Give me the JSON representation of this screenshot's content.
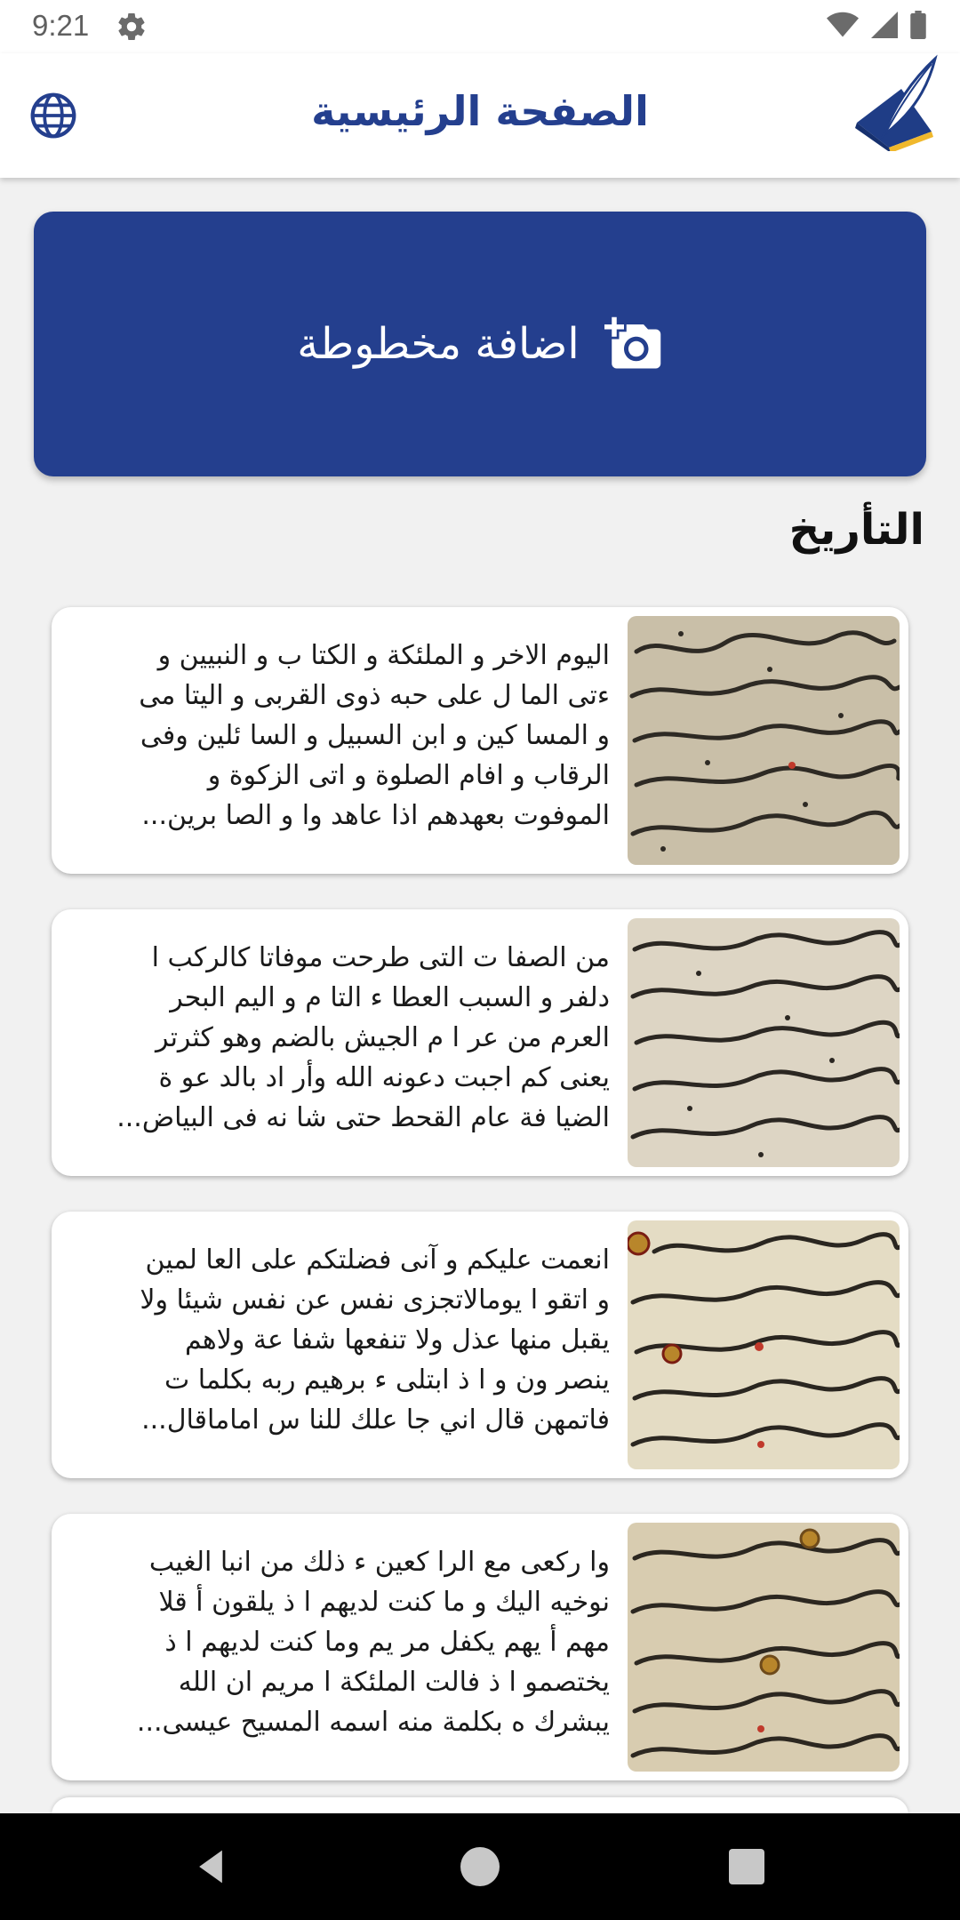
{
  "status_bar": {
    "time": "9:21"
  },
  "app_bar": {
    "title": "الصفحة الرئيسية"
  },
  "add_button": {
    "label": "اضافة مخطوطة"
  },
  "history": {
    "heading": "التأريخ",
    "items": [
      {
        "text": "اليوم الاخر و الملئكة و الكتا ب و النبيين و\nءتى الما ل على حبه ذوى القربى و اليتا مى\nو المسا كين و ابن السبيل و السا ئلين وفى\nالرقاب و افام الصلوة و اتى الزكوة و\nالموفوت بعهدهم اذا عاهد وا و الصا برين..."
      },
      {
        "text": "من الصفا ت التى طرحت موفاتا كالركب ا\nدلفر و السبب العطا ء التا م و اليم البحر\nالعرم من عر ا م الجيش  بالضم وهو كثرتر\nيعنى كم  اجبت دعونه الله وأر اد بالد عو ة\nالضيا فة عام القحط حتى شا نه فى البياض..."
      },
      {
        "text": "انعمت عليكم و آنى فضلتكم على العا لمين\nو اتقو ا يومالاتجزى نفس عن نفس شيئا ولا\nيقبل منها عذل ولا تنفعها شفا عة ولاهم\nينصر ون و ا ذ ابتلى ء برهيم ربه بكلما ت\nفاتمهن قال اني جا علك للنا س اماماقال..."
      },
      {
        "text": "وا ركعى مع الرا كعين ء ذلك من انبا الغيب\nنوخيه اليك و ما كنت لديهم ا ذ يلقون أ قلا\nمهم أ يهم يكفل مر يم وما كنت لديهم ا ذ\nيختصمو ا ذ فالت  الملئكة ا مريم  ان الله\nيبشرك ه بكلمة منه اسمه المسيح عيسى..."
      }
    ]
  },
  "colors": {
    "primary": "#243f8e",
    "background": "#f1f1f1"
  },
  "icons": {
    "settings": "gear-icon",
    "language": "globe-icon",
    "logo": "quill-book-logo",
    "add": "add-photo-icon"
  }
}
